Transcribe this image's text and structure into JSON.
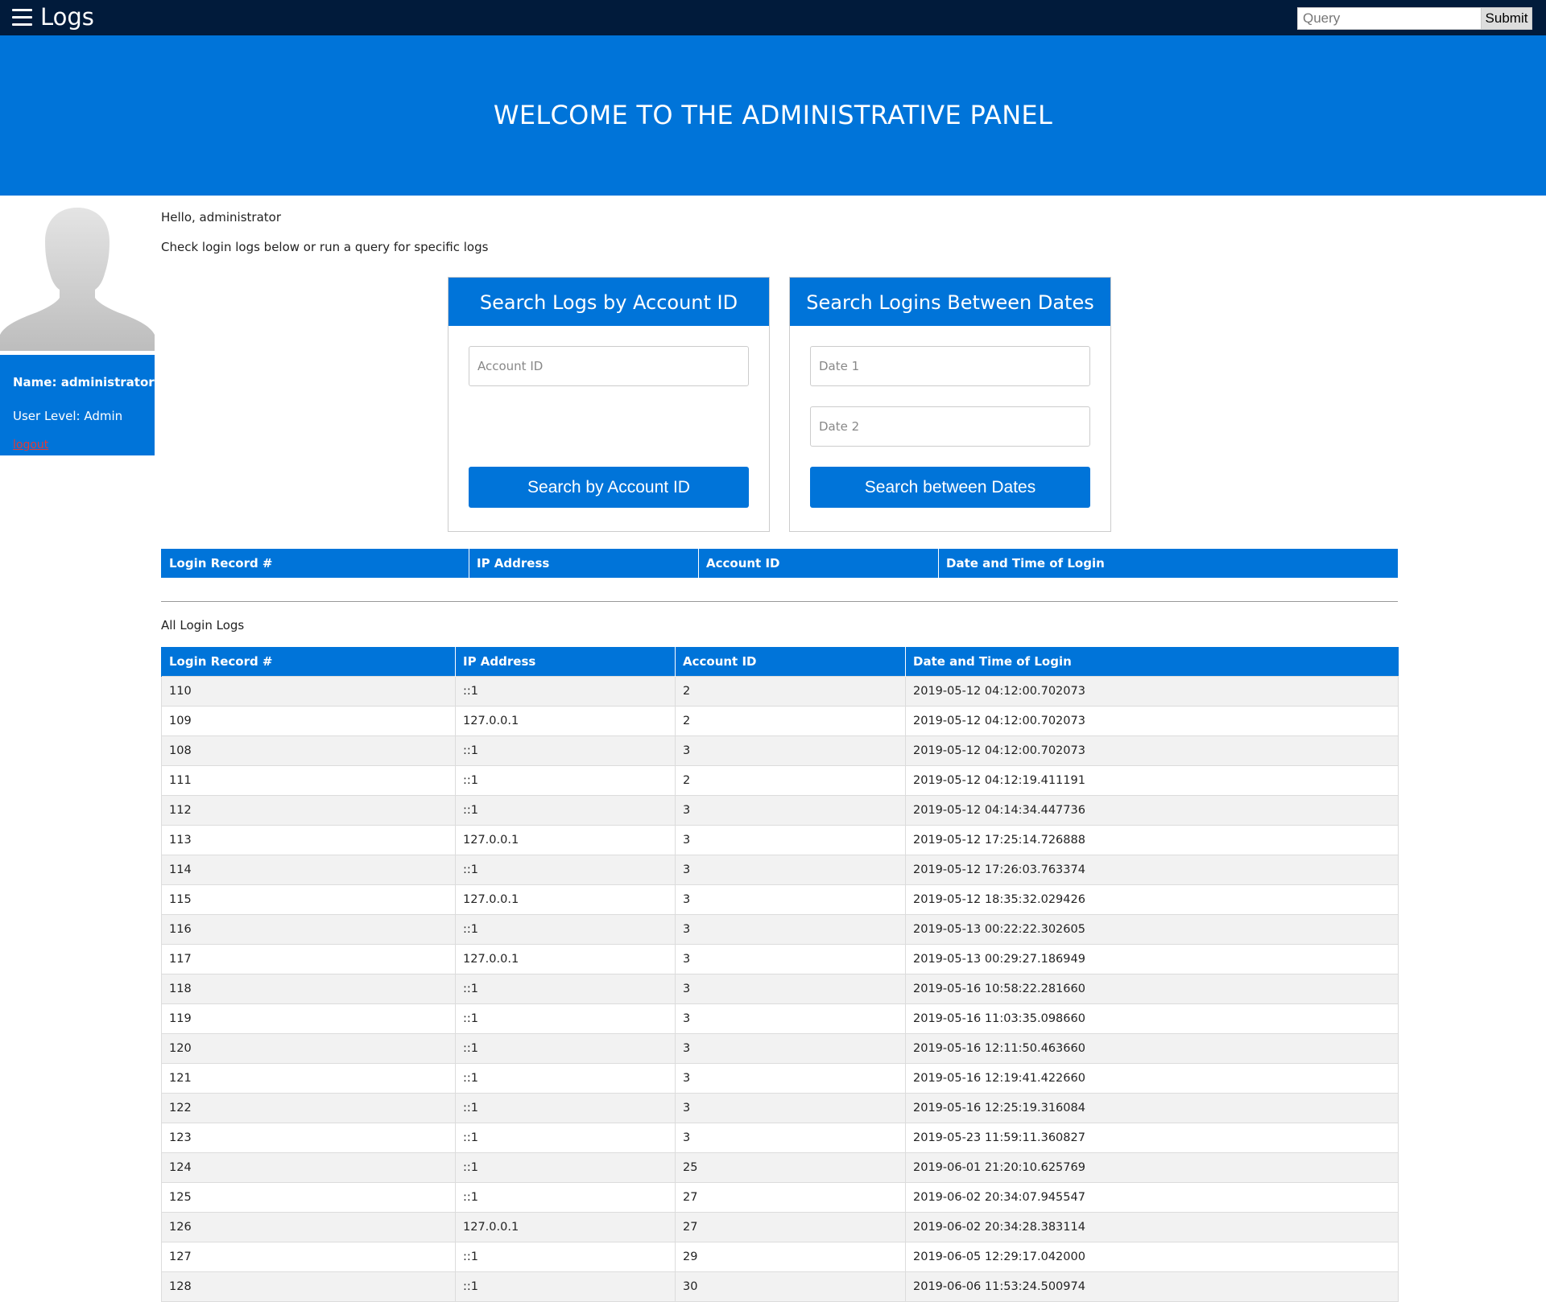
{
  "topbar": {
    "menu_icon": "hamburger-menu-icon",
    "title": "Logs",
    "query_placeholder": "Query",
    "submit_label": "Submit"
  },
  "hero": {
    "title": "WELCOME TO THE ADMINISTRATIVE PANEL"
  },
  "colors": {
    "nav_bg": "#011b3b",
    "accent": "#0074d9",
    "logout": "#e53935"
  },
  "profile": {
    "avatar_icon": "user-silhouette-icon",
    "name": "Name: administrator",
    "level": "User Level: Admin",
    "logout_label": "logout"
  },
  "main": {
    "greeting": "Hello, administrator",
    "intro": "Check login logs below or run a query for specific logs"
  },
  "search_by_account": {
    "title": "Search Logs by Account ID",
    "input_placeholder": "Account ID",
    "button_label": "Search by Account ID"
  },
  "search_by_dates": {
    "title": "Search Logins Between Dates",
    "date1_placeholder": "Date 1",
    "date2_placeholder": "Date 2",
    "button_label": "Search between Dates"
  },
  "result_table": {
    "headers": [
      "Login Record #",
      "IP Address",
      "Account ID",
      "Date and Time of Login"
    ]
  },
  "all_logs": {
    "label": "All Login Logs",
    "headers": [
      "Login Record #",
      "IP Address",
      "Account ID",
      "Date and Time of Login"
    ],
    "rows": [
      [
        "110",
        "::1",
        "2",
        "2019-05-12 04:12:00.702073"
      ],
      [
        "109",
        "127.0.0.1",
        "2",
        "2019-05-12 04:12:00.702073"
      ],
      [
        "108",
        "::1",
        "3",
        "2019-05-12 04:12:00.702073"
      ],
      [
        "111",
        "::1",
        "2",
        "2019-05-12 04:12:19.411191"
      ],
      [
        "112",
        "::1",
        "3",
        "2019-05-12 04:14:34.447736"
      ],
      [
        "113",
        "127.0.0.1",
        "3",
        "2019-05-12 17:25:14.726888"
      ],
      [
        "114",
        "::1",
        "3",
        "2019-05-12 17:26:03.763374"
      ],
      [
        "115",
        "127.0.0.1",
        "3",
        "2019-05-12 18:35:32.029426"
      ],
      [
        "116",
        "::1",
        "3",
        "2019-05-13 00:22:22.302605"
      ],
      [
        "117",
        "127.0.0.1",
        "3",
        "2019-05-13 00:29:27.186949"
      ],
      [
        "118",
        "::1",
        "3",
        "2019-05-16 10:58:22.281660"
      ],
      [
        "119",
        "::1",
        "3",
        "2019-05-16 11:03:35.098660"
      ],
      [
        "120",
        "::1",
        "3",
        "2019-05-16 12:11:50.463660"
      ],
      [
        "121",
        "::1",
        "3",
        "2019-05-16 12:19:41.422660"
      ],
      [
        "122",
        "::1",
        "3",
        "2019-05-16 12:25:19.316084"
      ],
      [
        "123",
        "::1",
        "3",
        "2019-05-23 11:59:11.360827"
      ],
      [
        "124",
        "::1",
        "25",
        "2019-06-01 21:20:10.625769"
      ],
      [
        "125",
        "::1",
        "27",
        "2019-06-02 20:34:07.945547"
      ],
      [
        "126",
        "127.0.0.1",
        "27",
        "2019-06-02 20:34:28.383114"
      ],
      [
        "127",
        "::1",
        "29",
        "2019-06-05 12:29:17.042000"
      ],
      [
        "128",
        "::1",
        "30",
        "2019-06-06 11:53:24.500974"
      ]
    ]
  }
}
